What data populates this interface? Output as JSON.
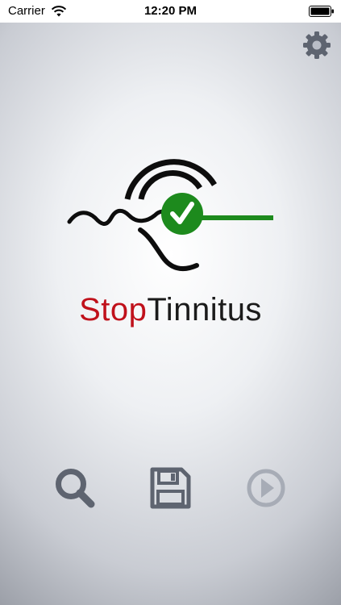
{
  "status_bar": {
    "carrier": "Carrier",
    "time": "12:20 PM",
    "wifi_icon": "wifi-icon",
    "battery_icon": "battery-full-icon"
  },
  "header": {
    "settings_icon": "gear-icon"
  },
  "logo": {
    "brand_part1": "Stop",
    "brand_part2": "Tinnitus",
    "colors": {
      "stop_red": "#c0111b",
      "check_green": "#1d8a1d",
      "ink": "#0d0d0d"
    }
  },
  "toolbar": {
    "items": [
      {
        "icon": "search-icon",
        "enabled": true
      },
      {
        "icon": "save-icon",
        "enabled": true
      },
      {
        "icon": "play-icon",
        "enabled": false
      }
    ],
    "colors": {
      "active": "#5e6470",
      "disabled": "#a7acb6"
    }
  }
}
